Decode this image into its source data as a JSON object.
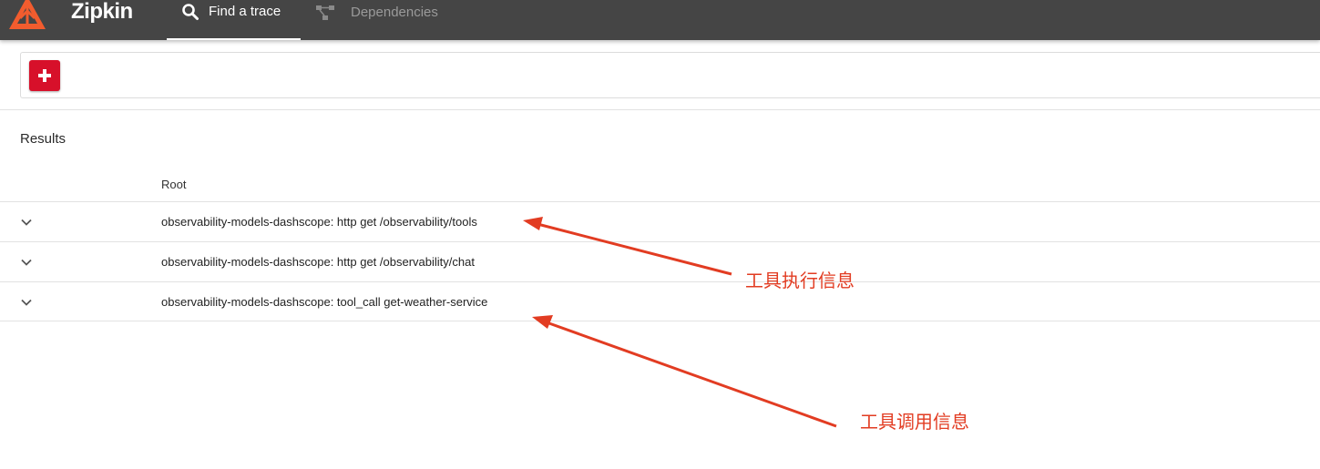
{
  "header": {
    "brand": "Zipkin",
    "tabs": [
      {
        "label": "Find a trace",
        "icon": "search-icon",
        "active": true
      },
      {
        "label": "Dependencies",
        "icon": "dependency-graph-icon",
        "active": false
      }
    ],
    "background_color": "#454545",
    "logo_color": "#f25c2e"
  },
  "search": {
    "add_button_icon": "plus-icon",
    "add_button_color": "#d7102a"
  },
  "results": {
    "title": "Results",
    "column_header": "Root",
    "rows": [
      {
        "text": "observability-models-dashscope: http get /observability/tools",
        "icon": "chevron-down-icon"
      },
      {
        "text": "observability-models-dashscope: http get /observability/chat",
        "icon": "chevron-down-icon"
      },
      {
        "text": "observability-models-dashscope: tool_call get-weather-service",
        "icon": "chevron-down-icon"
      }
    ]
  },
  "annotations": {
    "color": "#e23c22",
    "label_1": "工具执行信息",
    "label_2": "工具调用信息"
  }
}
